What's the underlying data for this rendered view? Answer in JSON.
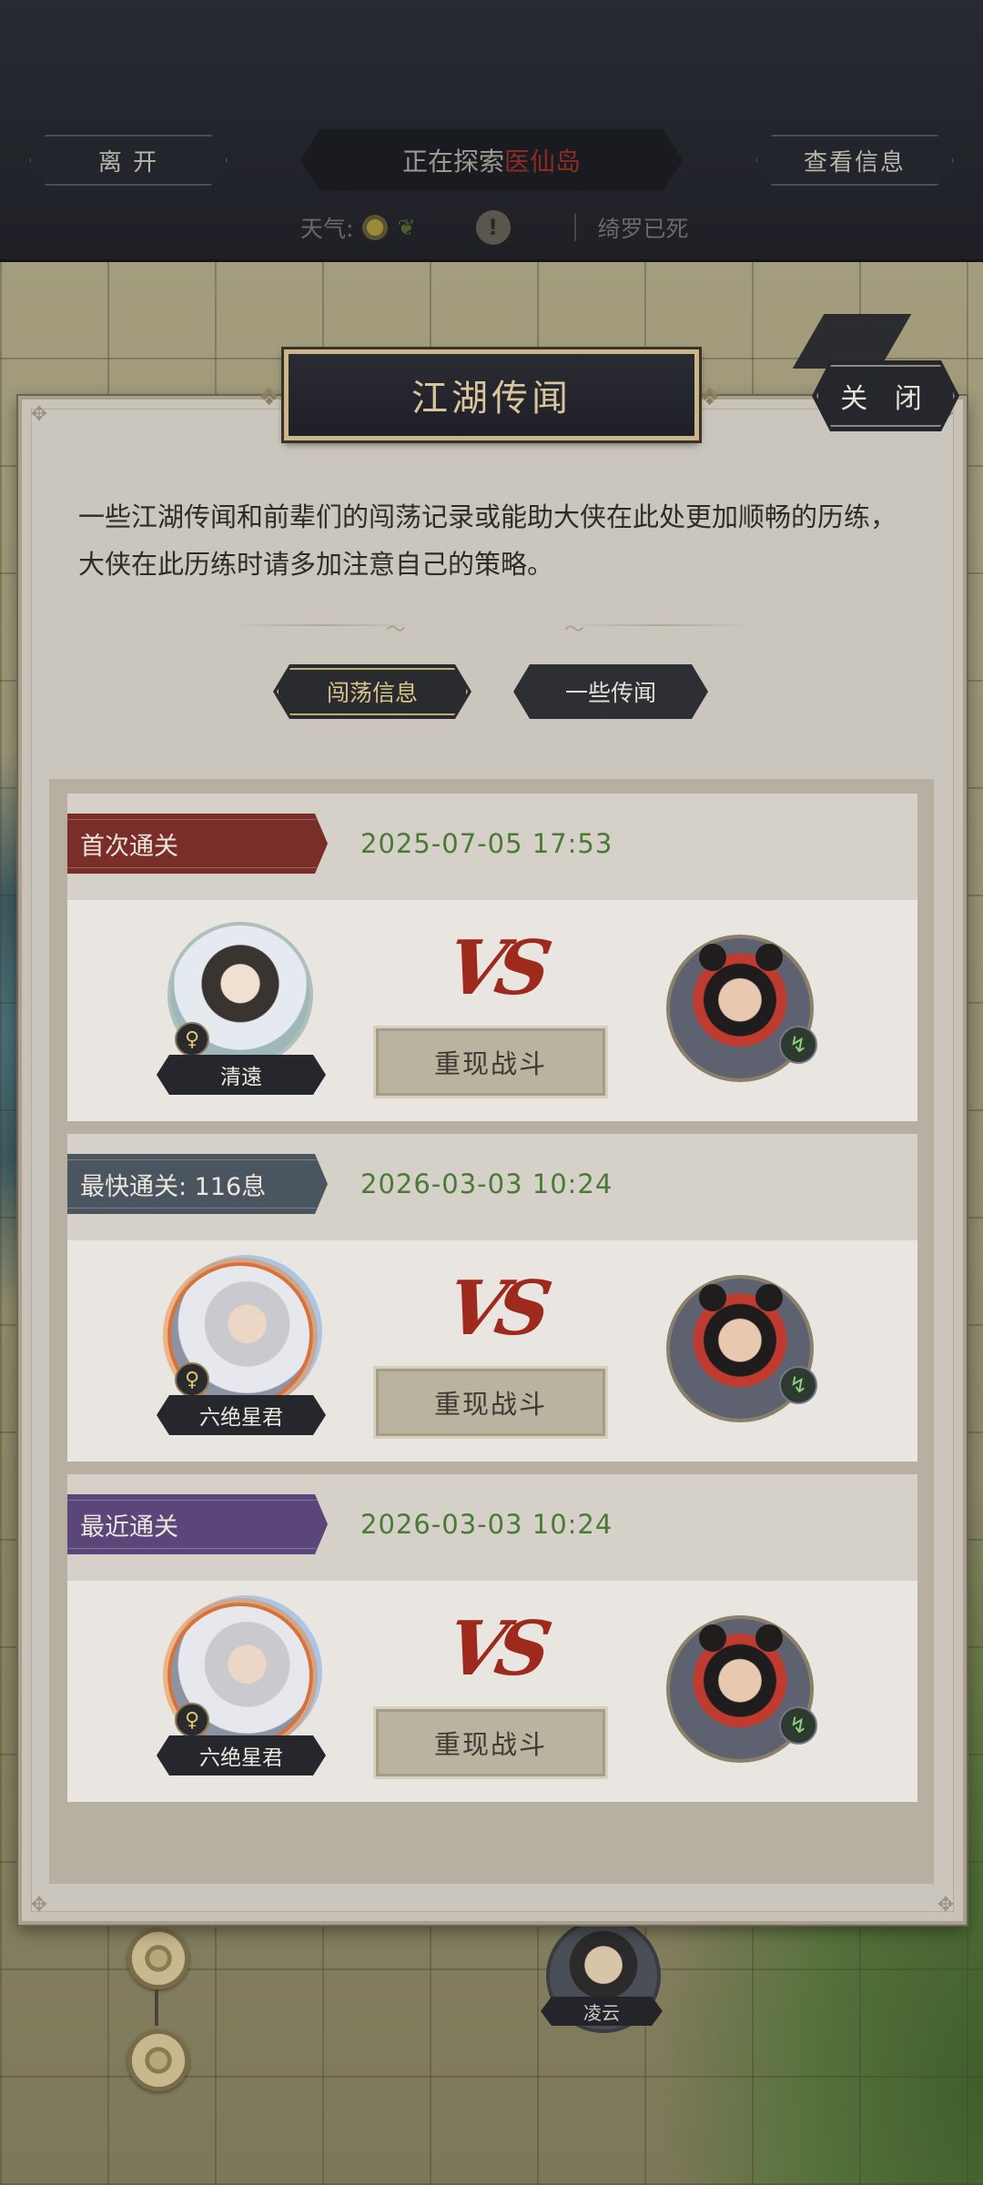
{
  "header": {
    "leave_label": "离 开",
    "exploring_prefix": "正在探索",
    "location": "医仙岛",
    "info_label": "查看信息",
    "weather_label": "天气:",
    "weather_icon": "sun-icon",
    "status_text": "绮罗已死"
  },
  "modal": {
    "title": "江湖传闻",
    "close_label": "关 闭",
    "description": "一些江湖传闻和前辈们的闯荡记录或能助大侠在此处更加顺畅的历练，大侠在此历练时请多加注意自己的策略。",
    "tabs": [
      {
        "label": "闯荡信息",
        "active": true
      },
      {
        "label": "一些传闻",
        "active": false
      }
    ]
  },
  "records": [
    {
      "badge": "首次通关",
      "badge_color": "#7a2e2a",
      "date": "2025-07-05 17:53",
      "hero_name": "清遠",
      "gender": "♀",
      "vs": "VS",
      "replay_label": "重现战斗"
    },
    {
      "badge": "最快通关: 116息",
      "badge_color": "#4a5560",
      "date": "2026-03-03 10:24",
      "hero_name": "六绝星君",
      "gender": "♀",
      "vs": "VS",
      "replay_label": "重现战斗"
    },
    {
      "badge": "最近通关",
      "badge_color": "#5a4678",
      "date": "2026-03-03 10:24",
      "hero_name": "六绝星君",
      "gender": "♀",
      "vs": "VS",
      "replay_label": "重现战斗"
    }
  ],
  "map": {
    "npc_name": "凌云"
  },
  "colors": {
    "accent_gold": "#d8c59b",
    "date_green": "#4b7a36",
    "vs_red": "#9e2a1e"
  }
}
